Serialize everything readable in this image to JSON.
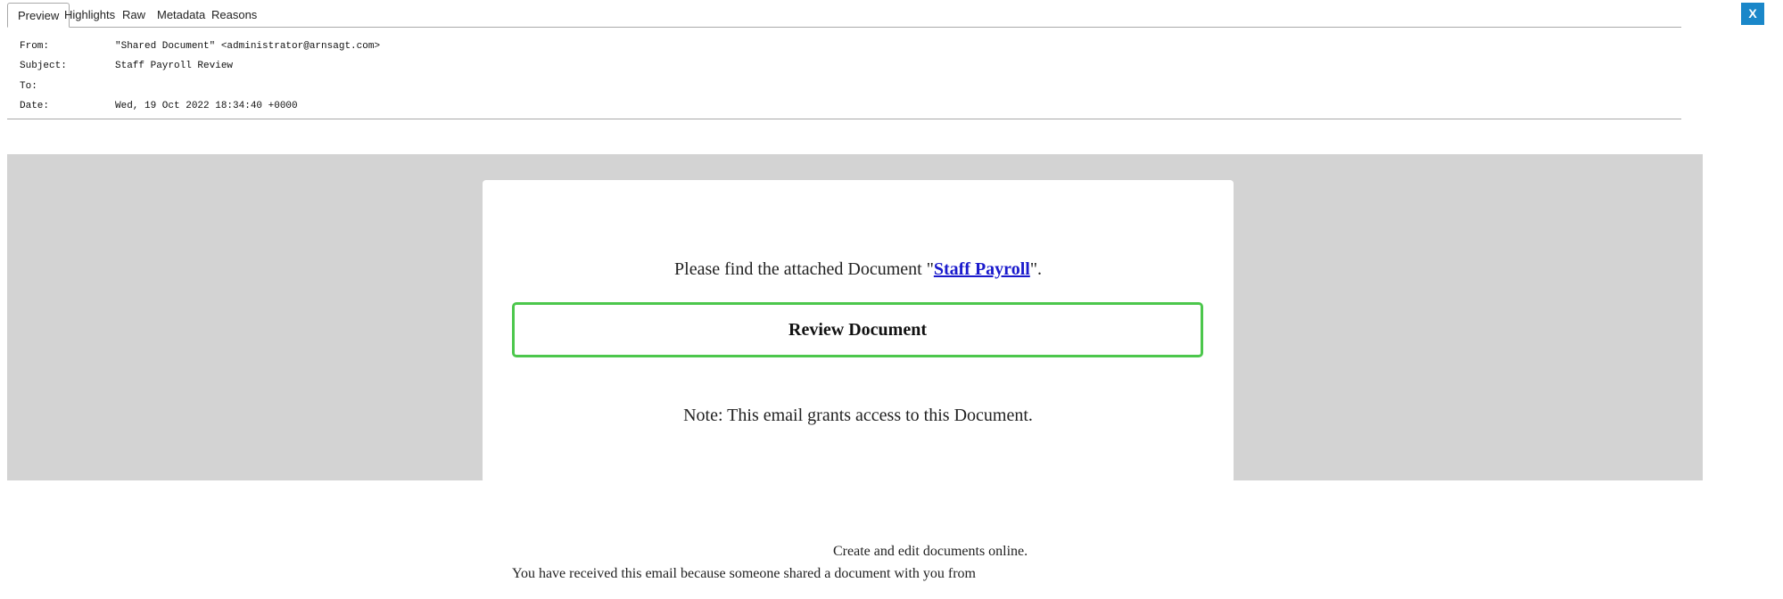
{
  "tabs": [
    {
      "label": "Preview"
    },
    {
      "label": "Highlights"
    },
    {
      "label": "Raw"
    },
    {
      "label": "Metadata"
    },
    {
      "label": "Reasons"
    }
  ],
  "close_label": "X",
  "headers": {
    "from": {
      "label": "From:",
      "value": "\"Shared Document\" <administrator@arnsagt.com>"
    },
    "subject": {
      "label": "Subject:",
      "value": "Staff Payroll Review"
    },
    "to": {
      "label": "To:",
      "value": ""
    },
    "date": {
      "label": "Date:",
      "value": "Wed, 19 Oct 2022 18:34:40 +0000"
    }
  },
  "email": {
    "intro_prefix": "Please find the attached Document \"",
    "doc_link": "Staff Payroll",
    "intro_suffix": "\".",
    "review_button": "Review Document",
    "note": "Note: This email grants access to this Document."
  },
  "footer": {
    "line1": "Create and edit documents online.",
    "line2": "You have received this email because someone shared a document with you from"
  },
  "colors": {
    "close_button": "#1a87c9",
    "band": "#d3d3d3",
    "button_border": "#4cc74c",
    "link": "#1a1acc"
  }
}
